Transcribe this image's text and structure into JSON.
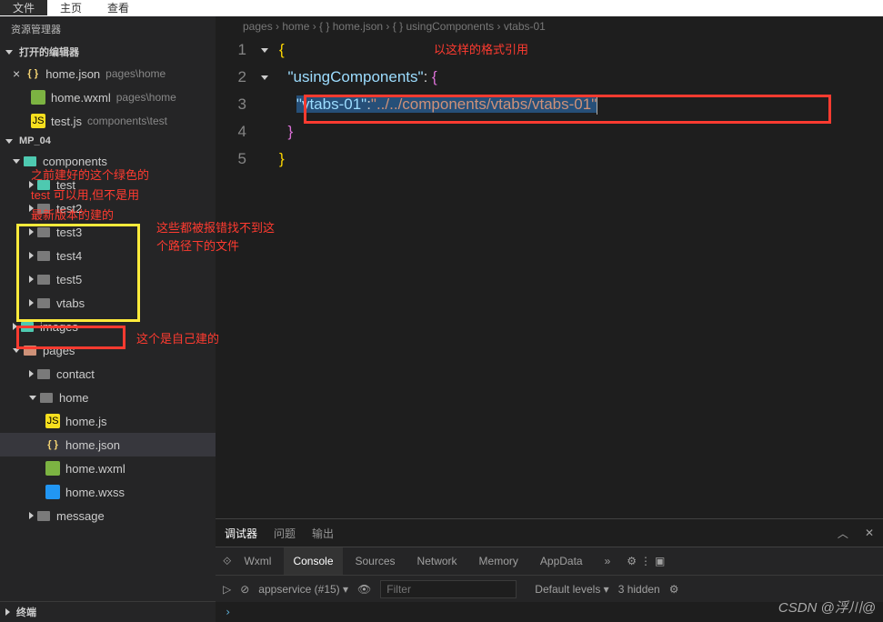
{
  "topTabs": {
    "t0": "文件",
    "t1": "主页",
    "t2": "查看"
  },
  "sidebar": {
    "title": "资源管理器",
    "openEditors": "打开的编辑器",
    "project": "MP_04",
    "terminal": "终端",
    "editors": [
      {
        "name": "home.json",
        "path": "pages\\home",
        "iconText": "{ }",
        "close": "×"
      },
      {
        "name": "home.wxml",
        "path": "pages\\home",
        "iconText": ""
      },
      {
        "name": "test.js",
        "path": "components\\test",
        "iconText": "JS"
      }
    ],
    "tree": {
      "components": "components",
      "test": "test",
      "test2": "test2",
      "test3": "test3",
      "test4": "test4",
      "test5": "test5",
      "vtabs": "vtabs",
      "images": "images",
      "pages": "pages",
      "contact": "contact",
      "home": "home",
      "homejs": "home.js",
      "homejson": "home.json",
      "homewxml": "home.wxml",
      "homewxss": "home.wxss",
      "message": "message"
    }
  },
  "annotations": {
    "topRed": "以这样的格式引用",
    "green1": "之前建好的这个绿色的",
    "green2": "test 可以用,但不是用",
    "green3": "最新版本的建的",
    "yellow1": "这些都被报错找不到这",
    "yellow2": "个路径下的文件",
    "redBox": "这个是自己建的"
  },
  "breadcrumb": "pages › home › { } home.json › { } usingComponents › vtabs-01",
  "code": {
    "l1": "{",
    "l2key": "\"usingComponents\"",
    "l2colon": ": ",
    "l2brace": "{",
    "l3key": "\"vtabs-01\"",
    "l3colon": ":",
    "l3val": "\"../../components/vtabs/vtabs-01\"",
    "l4": "}",
    "l5": "}"
  },
  "bottom": {
    "tabs": {
      "debugger": "调试器",
      "problems": "问题",
      "output": "输出"
    },
    "dtTabs": {
      "wxml": "Wxml",
      "console": "Console",
      "sources": "Sources",
      "network": "Network",
      "memory": "Memory",
      "appdata": "AppData",
      "more": "»"
    },
    "context": "appservice (#15)",
    "filterPlaceholder": "Filter",
    "levels": "Default levels",
    "hidden": "3 hidden",
    "gear": "⚙",
    "prompt": "›"
  },
  "watermark": "CSDN @浮川@"
}
